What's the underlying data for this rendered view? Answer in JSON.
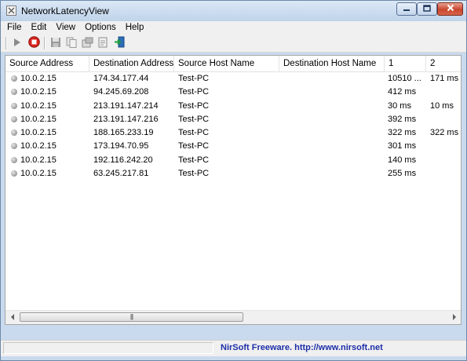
{
  "window": {
    "title": "NetworkLatencyView",
    "accent": "#c9daee",
    "close_color": "#c9452d"
  },
  "menu": {
    "items": [
      "File",
      "Edit",
      "View",
      "Options",
      "Help"
    ]
  },
  "toolbar": {
    "buttons": [
      "start-icon",
      "stop-icon",
      "save-icon",
      "copy-icon",
      "properties-icon",
      "html-report-icon",
      "exit-icon"
    ]
  },
  "table": {
    "columns": [
      "Source Address",
      "Destination Address",
      "Source Host Name",
      "Destination Host Name",
      "1",
      "2"
    ],
    "rows": [
      {
        "source": "10.0.2.15",
        "dest": "174.34.177.44",
        "src_host": "Test-PC",
        "dest_host": "",
        "c1": "10510 ...",
        "c2": "171 ms"
      },
      {
        "source": "10.0.2.15",
        "dest": "94.245.69.208",
        "src_host": "Test-PC",
        "dest_host": "",
        "c1": "412 ms",
        "c2": ""
      },
      {
        "source": "10.0.2.15",
        "dest": "213.191.147.214",
        "src_host": "Test-PC",
        "dest_host": "",
        "c1": "30 ms",
        "c2": "10 ms"
      },
      {
        "source": "10.0.2.15",
        "dest": "213.191.147.216",
        "src_host": "Test-PC",
        "dest_host": "",
        "c1": "392 ms",
        "c2": ""
      },
      {
        "source": "10.0.2.15",
        "dest": "188.165.233.19",
        "src_host": "Test-PC",
        "dest_host": "",
        "c1": "322 ms",
        "c2": "322 ms"
      },
      {
        "source": "10.0.2.15",
        "dest": "173.194.70.95",
        "src_host": "Test-PC",
        "dest_host": "",
        "c1": "301 ms",
        "c2": ""
      },
      {
        "source": "10.0.2.15",
        "dest": "192.116.242.20",
        "src_host": "Test-PC",
        "dest_host": "",
        "c1": "140 ms",
        "c2": ""
      },
      {
        "source": "10.0.2.15",
        "dest": "63.245.217.81",
        "src_host": "Test-PC",
        "dest_host": "",
        "c1": "255 ms",
        "c2": ""
      }
    ]
  },
  "statusbar": {
    "credits": "NirSoft Freeware.  http://www.nirsoft.net",
    "credits_color": "#1d2fa8"
  }
}
